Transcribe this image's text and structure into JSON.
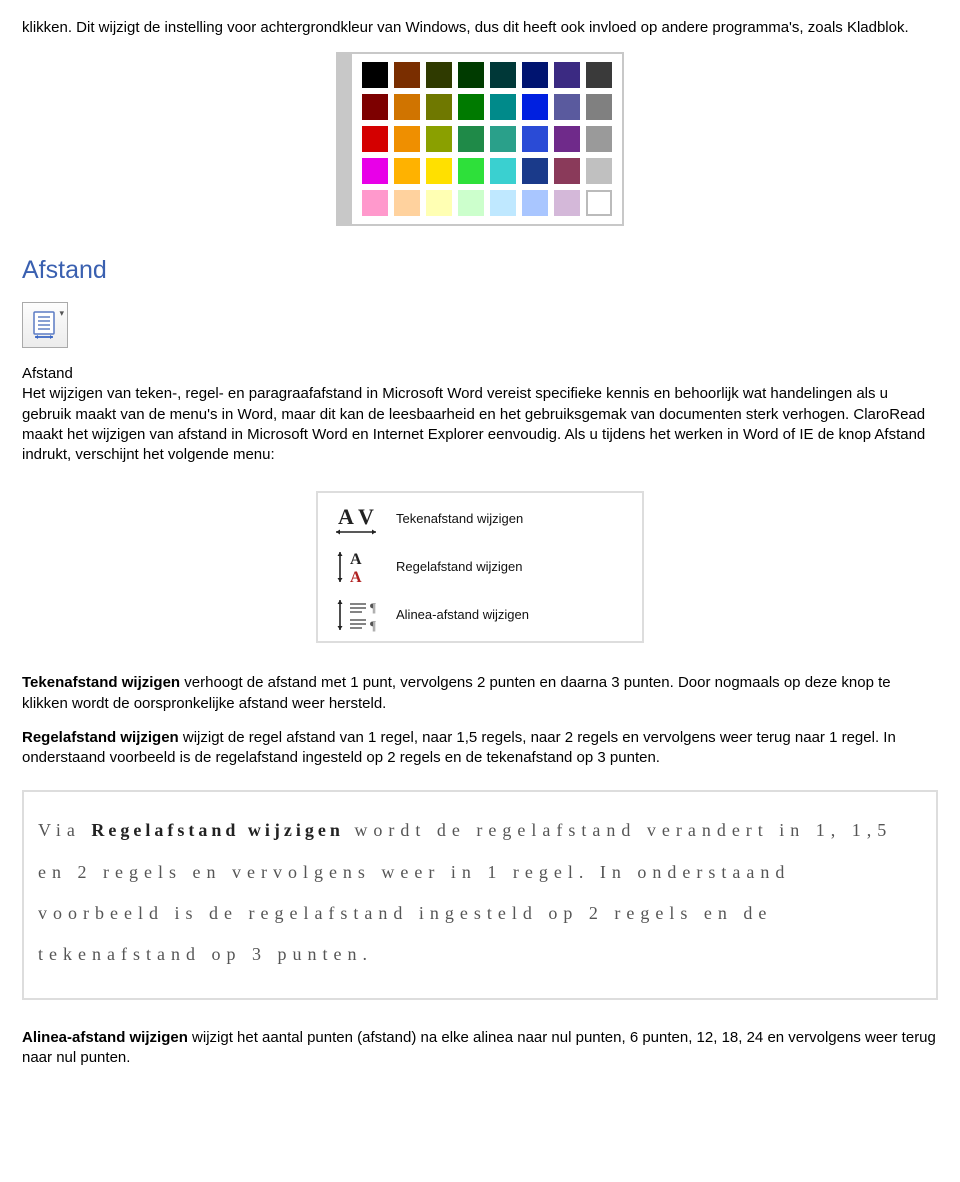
{
  "intro": {
    "p1": "klikken. Dit wijzigt de instelling voor achtergrondkleur van Windows, dus dit heeft ook invloed op andere programma's, zoals Kladblok."
  },
  "palette": {
    "row1": [
      "#000000",
      "#7a2e00",
      "#2f3a00",
      "#003b00",
      "#003838",
      "#001470",
      "#3b2a82",
      "#3a3a3a"
    ],
    "row2": [
      "#7d0000",
      "#d07400",
      "#6f7800",
      "#007a00",
      "#008a8a",
      "#0020e0",
      "#5a5a9e",
      "#808080"
    ],
    "row3": [
      "#d40000",
      "#ef8f00",
      "#8aa000",
      "#1f8a48",
      "#2aa08a",
      "#2a4bd6",
      "#6f2a8a",
      "#9a9a9a"
    ],
    "row4": [
      "#e800e8",
      "#ffb200",
      "#ffe000",
      "#2ee03a",
      "#3ad0d0",
      "#1a3a8a",
      "#8a3a5a",
      "#c0c0c0"
    ],
    "row5": [
      "#ff99cc",
      "#ffd29e",
      "#ffffb3",
      "#ccffcc",
      "#bfe8ff",
      "#a9c6ff",
      "#d4b8d9",
      "outline"
    ]
  },
  "section": {
    "title": "Afstand"
  },
  "iconlabel": "Afstand",
  "body": {
    "p1": "Het wijzigen van teken-, regel- en paragraafafstand in Microsoft Word vereist specifieke kennis en behoorlijk wat handelingen als u gebruik maakt van de menu's in Word, maar dit kan de leesbaarheid en het gebruiksgemak van documenten sterk verhogen. ClaroRead maakt het wijzigen van afstand in Microsoft Word en Internet Explorer eenvoudig. Als u tijdens het werken in Word of IE de knop Afstand indrukt, verschijnt het volgende menu:"
  },
  "menu": {
    "item1": "Tekenafstand wijzigen",
    "item2": "Regelafstand wijzigen",
    "item3": "Alinea-afstand wijzigen"
  },
  "para2": {
    "bold": "Tekenafstand wijzigen",
    "rest": " verhoogt de afstand met 1 punt, vervolgens 2 punten en daarna 3 punten. Door nogmaals op deze knop te klikken wordt de oorspronkelijke afstand weer hersteld."
  },
  "para3": {
    "bold": "Regelafstand wijzigen",
    "rest": " wijzigt de regel afstand van 1 regel, naar 1,5 regels, naar 2 regels en vervolgens weer terug naar 1 regel. In onderstaand voorbeeld is de regelafstand ingesteld op 2 regels en de tekenafstand op 3 punten."
  },
  "example": {
    "pre": "Via ",
    "bold": "Regelafstand wijzigen",
    "post": " wordt de regelafstand verandert in 1, 1,5 en 2 regels en vervolgens weer in 1 regel. In onderstaand voorbeeld is de regelafstand ingesteld op 2 regels en de tekenafstand op 3 punten."
  },
  "para4": {
    "bold": "Alinea-afstand wijzigen",
    "rest": " wijzigt het aantal punten (afstand) na elke alinea naar nul punten, 6 punten, 12, 18, 24 en vervolgens weer terug naar nul punten."
  }
}
